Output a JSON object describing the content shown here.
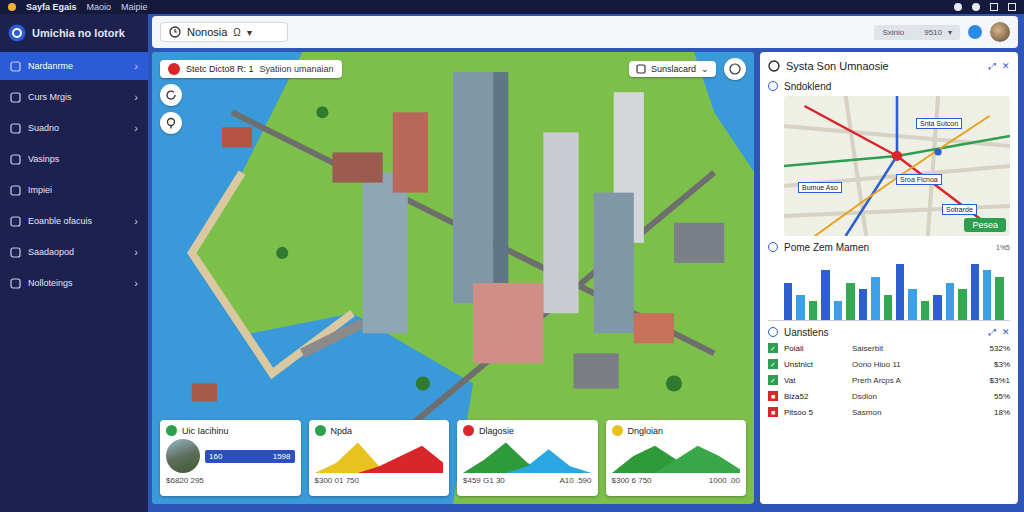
{
  "window": {
    "title": "Sayfa Egais",
    "menu": [
      "Maoio",
      "Maipie"
    ]
  },
  "sidebar": {
    "title": "Umichia no lotork",
    "items": [
      {
        "label": "Nardanrme",
        "selected": true,
        "chevron": "›"
      },
      {
        "label": "Curs Mrgis",
        "selected": false,
        "chevron": "›"
      },
      {
        "label": "Suadno",
        "selected": false,
        "chevron": "›"
      },
      {
        "label": "Vasinps",
        "selected": false,
        "chevron": ""
      },
      {
        "label": "Impiei",
        "selected": false,
        "chevron": ""
      },
      {
        "label": "Eoanble ofacuis",
        "selected": false,
        "chevron": "›"
      },
      {
        "label": "Saadaopod",
        "selected": false,
        "chevron": "›"
      },
      {
        "label": "Nolloteings",
        "selected": false,
        "chevron": "›"
      }
    ]
  },
  "toolbar": {
    "search": {
      "value": "Nonosia",
      "icon": "Ω",
      "caret": "▾"
    },
    "field": {
      "value": "Sxinio",
      "extra": "9510",
      "caret": "▾"
    }
  },
  "map": {
    "badge": {
      "title": "Stetc Dicto8 R: 1",
      "subtitle": "Syatiion umanaian"
    },
    "dropdown": {
      "value": "Sunslacard",
      "caret": "⌄"
    }
  },
  "cards": [
    {
      "kind": "photo",
      "title": "Uic Iacihinu",
      "icon_color": "#2e9e4f",
      "bar": [
        "160",
        "1598"
      ],
      "series": [],
      "footer": [
        "$6820 295"
      ]
    },
    {
      "kind": "chart",
      "title": "Npda",
      "icon_color": "#2e9e4f",
      "bar": [],
      "series": [
        {
          "color": "#e8c21e",
          "values": [
            0,
            3,
            9,
            2,
            0,
            0,
            0
          ]
        },
        {
          "color": "#d8262b",
          "values": [
            0,
            0,
            0,
            2,
            5,
            8,
            3
          ]
        }
      ],
      "footer": [
        "$300 01 750"
      ]
    },
    {
      "kind": "chart",
      "title": "Dlagosie",
      "icon_color": "#d8262b",
      "bar": [],
      "series": [
        {
          "color": "#2e9a3a",
          "values": [
            0,
            4,
            9,
            3,
            0,
            0,
            0
          ]
        },
        {
          "color": "#2aa6e0",
          "values": [
            0,
            0,
            0,
            2,
            7,
            2,
            0
          ]
        }
      ],
      "footer": [
        "$459 G1 30",
        "A10 .590"
      ]
    },
    {
      "kind": "chart",
      "title": "Dngloian",
      "icon_color": "#e8c21e",
      "bar": [],
      "series": [
        {
          "color": "#2e9a3a",
          "values": [
            0,
            5,
            8,
            4,
            0,
            0,
            0
          ]
        },
        {
          "color": "#3aa64a",
          "values": [
            0,
            0,
            0,
            4,
            8,
            5,
            1
          ]
        }
      ],
      "footer": [
        "$300 6 750",
        "1000 .00"
      ]
    }
  ],
  "panel": {
    "title": "Systa Son Umnaosie",
    "actions": [
      "⤢",
      "✕"
    ],
    "routes": {
      "title": "Sndoklend",
      "labels": [
        "Snta Sutcon",
        "Bumue Aso",
        "Sroa Ficnoa",
        "Sotrarde"
      ],
      "button": "Pesea"
    },
    "chart": {
      "title": "Pome Zem Mamen",
      "label": "1%5",
      "series": [
        {
          "color": "#2f5fcf",
          "values": [
            6,
            8,
            5,
            9,
            4,
            9
          ]
        },
        {
          "color": "#3aa0e8",
          "values": [
            4,
            3,
            7,
            5,
            6,
            8
          ]
        },
        {
          "color": "#34a853",
          "values": [
            3,
            6,
            4,
            3,
            5,
            7
          ]
        }
      ]
    },
    "list": {
      "title": "Uanstlens",
      "actions": [
        "⤢",
        "✕"
      ],
      "rows": [
        {
          "name": "Poiali",
          "detail": "Saiserbit",
          "value": "532%",
          "icon": "✓",
          "color": "#2e9e4f"
        },
        {
          "name": "Unstnict",
          "detail": "Oono Hiuo 11",
          "value": "$3%",
          "icon": "✓",
          "color": "#2e9e4f"
        },
        {
          "name": "Vat",
          "detail": "Prerh Arcps A",
          "value": "$3%1",
          "icon": "✓",
          "color": "#2e9e4f"
        },
        {
          "name": "Biza52",
          "detail": "Dsdion",
          "value": "55%",
          "icon": "■",
          "color": "#d8262b"
        },
        {
          "name": "Pitsoo 5",
          "detail": "Sasmon",
          "value": "18%",
          "icon": "■",
          "color": "#d8262b"
        }
      ]
    }
  }
}
